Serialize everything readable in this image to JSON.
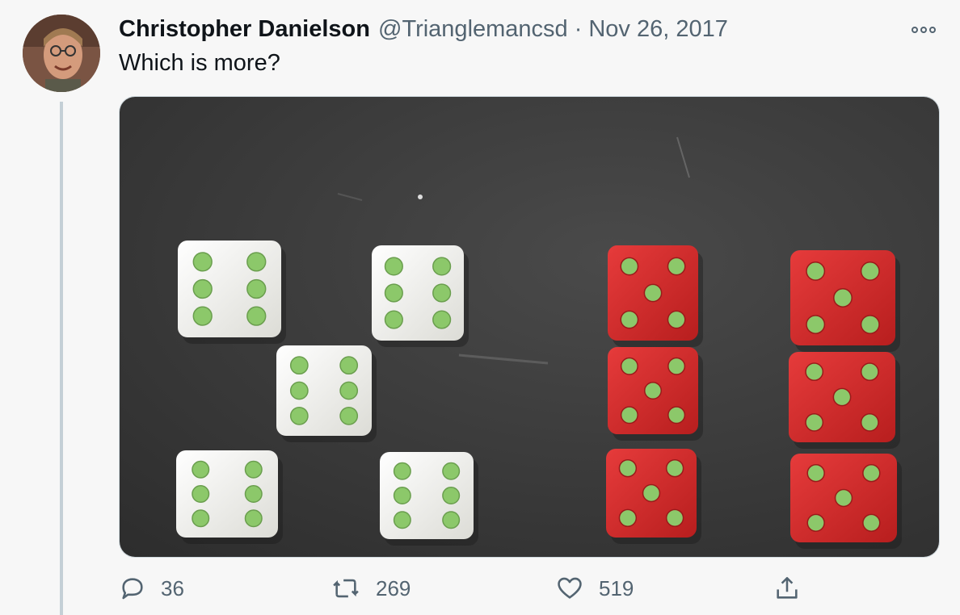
{
  "tweet": {
    "author_name": "Christopher Danielson",
    "handle": "@Trianglemancsd",
    "separator": "·",
    "date": "Nov 26, 2017",
    "text": "Which is more?"
  },
  "actions": {
    "reply_count": "36",
    "retweet_count": "269",
    "like_count": "519"
  },
  "colors": {
    "background": "#f7f7f7",
    "secondary_text": "#536471",
    "white_die": "#f2f2ee",
    "red_die": "#d62c2c",
    "pip": "#8cc86a",
    "table_surface": "#3b3b3b"
  },
  "media": {
    "white_dice_pips": [
      6,
      6,
      6,
      6,
      6
    ],
    "red_dice_pips": [
      5,
      5,
      5,
      5,
      5,
      5
    ]
  }
}
